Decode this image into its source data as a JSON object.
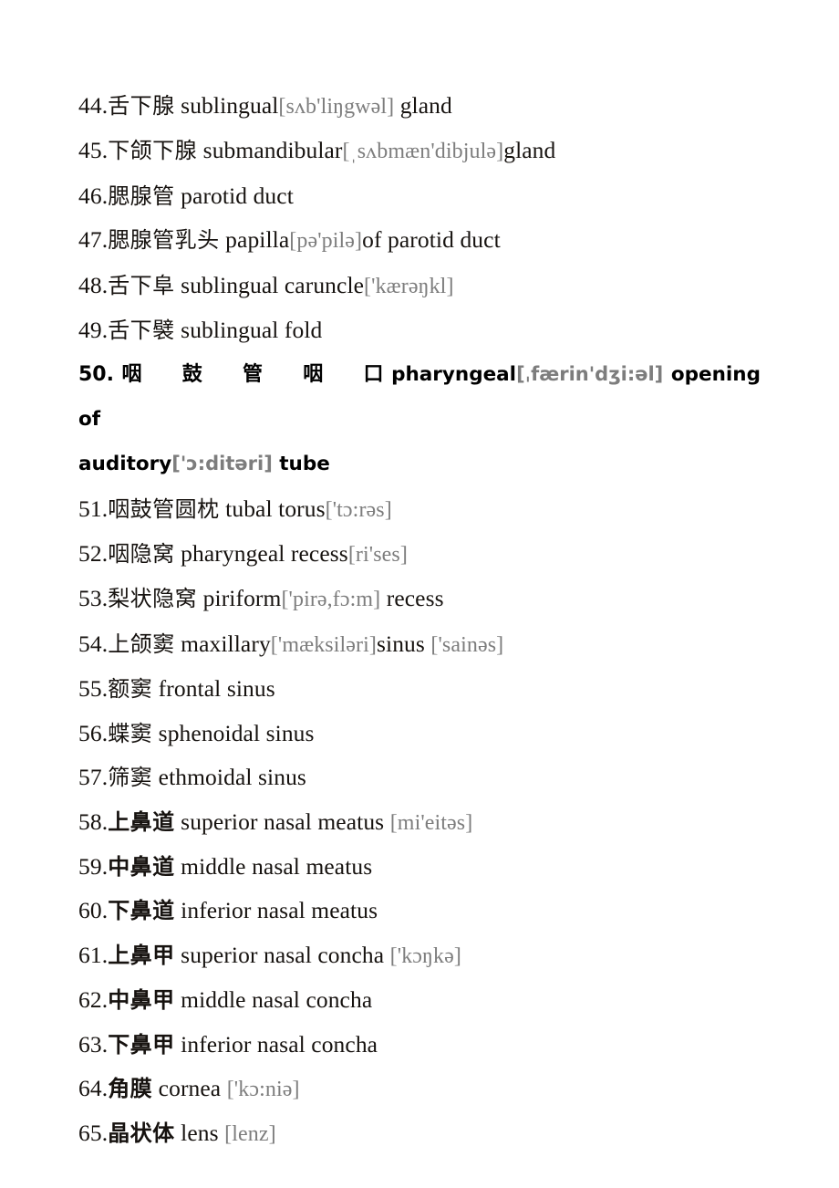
{
  "document": {
    "kind": "terminology-list",
    "language_pair": "Chinese-English",
    "page_background": "#ffffff",
    "text_color": "#16120f",
    "phonetic_color": "#7d7d7d"
  },
  "entries": [
    {
      "number": "44.",
      "chinese": "舌下腺",
      "english_before": "sublingual",
      "ipa": "[sʌb'liŋgwəl]",
      "english_after": " gland",
      "style": "regular"
    },
    {
      "number": "45.",
      "chinese": "下颌下腺",
      "english_before": "submandibular",
      "ipa": "[ˌsʌbmæn'dibjulə]",
      "english_after": "gland",
      "style": "regular"
    },
    {
      "number": "46.",
      "chinese": "腮腺管",
      "english_before": "parotid duct",
      "ipa": "",
      "english_after": "",
      "style": "regular"
    },
    {
      "number": "47.",
      "chinese": "腮腺管乳头",
      "english_before": "papilla",
      "ipa": "[pə'pilə]",
      "english_after": "of parotid duct",
      "style": "regular"
    },
    {
      "number": "48.",
      "chinese": "舌下阜",
      "english_before": "sublingual caruncle",
      "ipa": "['kærəŋkl]",
      "english_after": "",
      "style": "regular"
    },
    {
      "number": "49.",
      "chinese": "舌下襞",
      "english_before": "sublingual fold",
      "ipa": "",
      "english_after": "",
      "style": "regular"
    },
    {
      "number": "50.",
      "chinese": "咽鼓管咽口",
      "chinese_spread": [
        "咽",
        "鼓",
        "管",
        "咽",
        "口"
      ],
      "english_before": "pharyngeal",
      "ipa": "[ˌfærin'dʒi:əl]",
      "english_mid": "opening",
      "english_of": "of",
      "english_second_line_word": "auditory",
      "ipa2": "['ɔ:ditəri]",
      "english_after": " tube",
      "style": "bold-justified"
    },
    {
      "number": "51.",
      "chinese": "咽鼓管圆枕",
      "english_before": "tubal torus",
      "ipa": "['tɔ:rəs]",
      "english_after": "",
      "style": "regular"
    },
    {
      "number": "52.",
      "chinese": "咽隐窝",
      "english_before": "pharyngeal recess",
      "ipa": "[ri'ses]",
      "english_after": "",
      "style": "regular"
    },
    {
      "number": "53.",
      "chinese": "梨状隐窝",
      "english_before": "piriform",
      "ipa": "['pirə,fɔ:m]",
      "english_after": " recess",
      "style": "regular"
    },
    {
      "number": "54.",
      "chinese": "上颌窦",
      "english_before": "maxillary",
      "ipa": "['mæksiləri]",
      "english_after": "sinus",
      "ipa2": "['sainəs]",
      "style": "regular"
    },
    {
      "number": "55.",
      "chinese": "额窦",
      "english_before": "frontal sinus",
      "ipa": "",
      "english_after": "",
      "style": "regular"
    },
    {
      "number": "56.",
      "chinese": "蝶窦",
      "english_before": "sphenoidal sinus",
      "ipa": "",
      "english_after": "",
      "style": "regular"
    },
    {
      "number": "57.",
      "chinese": "筛窦",
      "english_before": "ethmoidal sinus",
      "ipa": "",
      "english_after": "",
      "style": "regular"
    },
    {
      "number": "58.",
      "chinese": "上鼻道",
      "english_before": "superior nasal meatus",
      "ipa": "[mi'eitəs]",
      "english_after": "",
      "style": "heavy-cjk"
    },
    {
      "number": "59.",
      "chinese": "中鼻道",
      "english_before": "middle nasal meatus",
      "ipa": "",
      "english_after": "",
      "style": "heavy-cjk"
    },
    {
      "number": "60.",
      "chinese": "下鼻道",
      "english_before": "inferior nasal meatus",
      "ipa": "",
      "english_after": "",
      "style": "heavy-cjk"
    },
    {
      "number": "61.",
      "chinese": "上鼻甲",
      "english_before": "superior nasal concha",
      "ipa": "['kɔŋkə]",
      "english_after": "",
      "style": "heavy-cjk"
    },
    {
      "number": "62.",
      "chinese": "中鼻甲",
      "english_before": "middle nasal concha",
      "ipa": "",
      "english_after": "",
      "style": "heavy-cjk"
    },
    {
      "number": "63.",
      "chinese": "下鼻甲",
      "english_before": "inferior nasal concha",
      "ipa": "",
      "english_after": "",
      "style": "heavy-cjk"
    },
    {
      "number": "64.",
      "chinese": "角膜",
      "english_before": "cornea",
      "ipa": "['kɔ:niə]",
      "english_after": "",
      "style": "heavy-cjk"
    },
    {
      "number": "65.",
      "chinese": "晶状体",
      "english_before": "lens",
      "ipa": "[lenz]",
      "english_after": "",
      "style": "heavy-cjk"
    }
  ]
}
